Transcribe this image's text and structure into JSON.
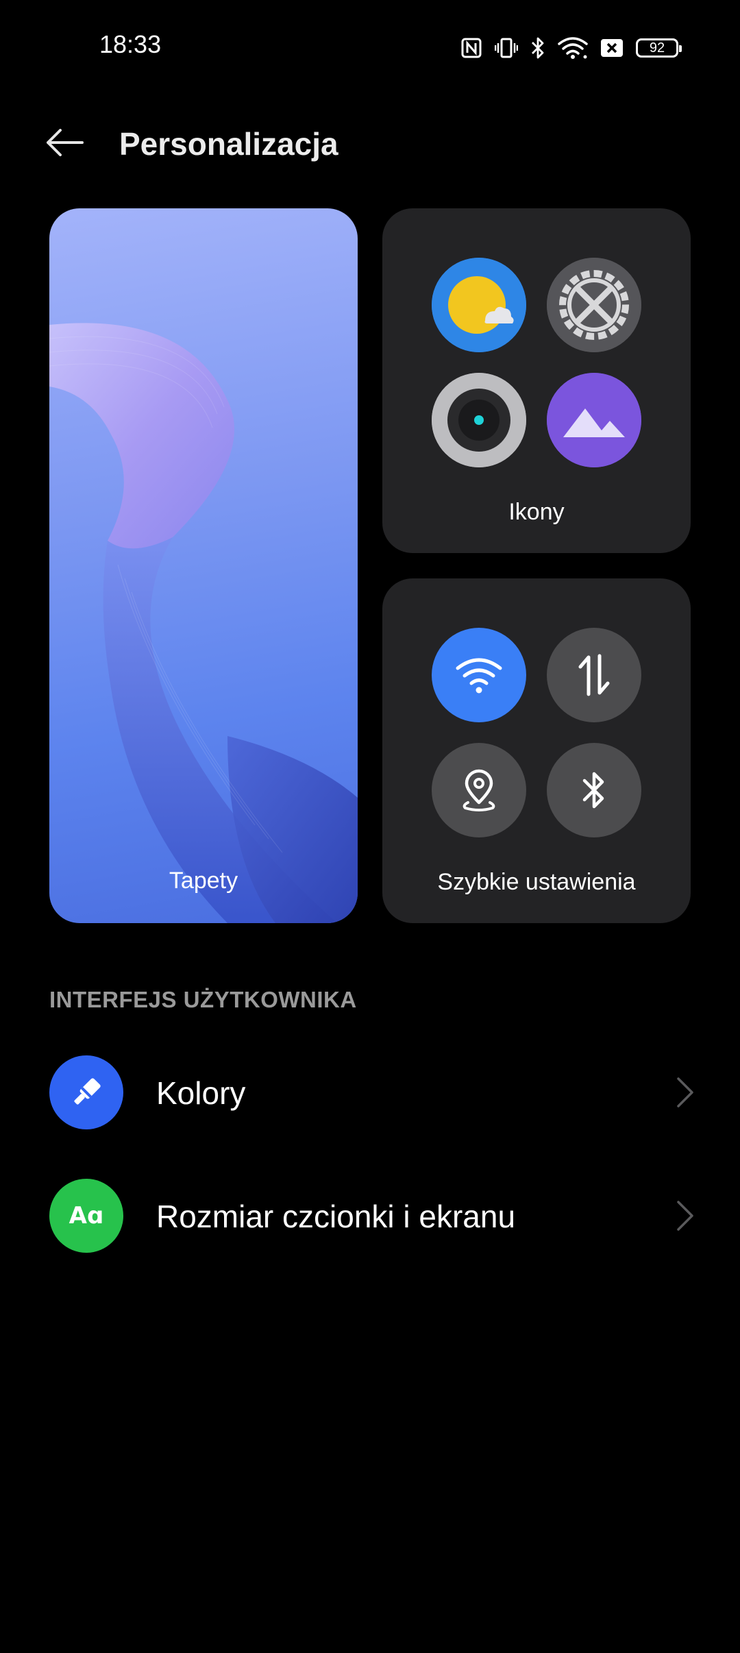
{
  "status_bar": {
    "time": "18:33",
    "battery": "92",
    "icons": [
      "nfc-icon",
      "vibrate-icon",
      "bluetooth-icon",
      "wifi-icon",
      "no-sim-icon",
      "battery-icon"
    ]
  },
  "header": {
    "title": "Personalizacja",
    "back_icon": "arrow-left-icon"
  },
  "cards": {
    "wallpaper": {
      "label": "Tapety"
    },
    "icons": {
      "label": "Ikony",
      "items": [
        "weather-icon",
        "settings-gear-icon",
        "camera-icon",
        "gallery-mountain-icon"
      ]
    },
    "quick_settings": {
      "label": "Szybkie ustawienia",
      "items": [
        "wifi-icon",
        "mobile-data-icon",
        "location-icon",
        "bluetooth-icon"
      ],
      "active_color": "#3a7ff6"
    }
  },
  "section": {
    "title": "INTERFEJS UŻYTKOWNIKA",
    "items": [
      {
        "label": "Kolory",
        "icon": "paint-brush-icon",
        "icon_color": "#2f63f2"
      },
      {
        "label": "Rozmiar czcionki i ekranu",
        "icon_text": "Aɑ",
        "icon_color": "#27c24c"
      }
    ]
  }
}
